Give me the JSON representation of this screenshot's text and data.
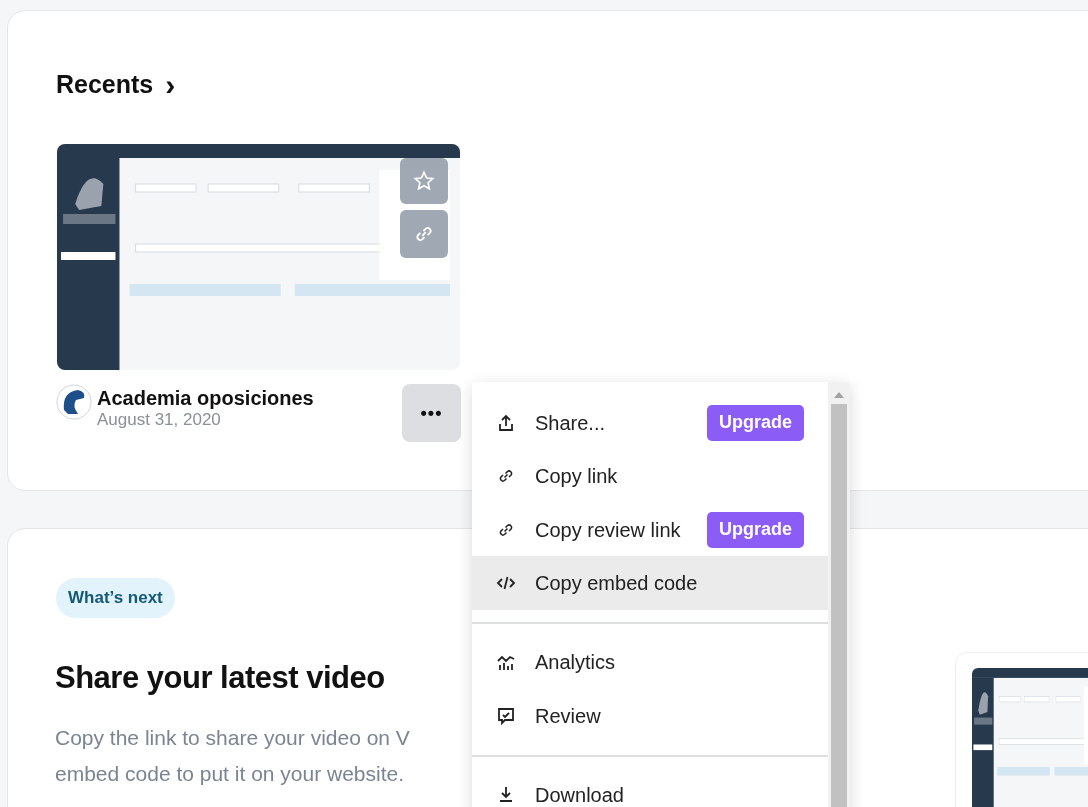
{
  "recents": {
    "title": "Recents",
    "arrow": "›",
    "video": {
      "kind": "picture",
      "title": "Academia oposiciones",
      "date": "August 31, 2020",
      "more": "•••"
    }
  },
  "menu": {
    "items": [
      {
        "kind": "item",
        "label": "Share...",
        "badge": "Upgrade",
        "selected": false
      },
      {
        "kind": "item",
        "label": "Copy link",
        "selected": false
      },
      {
        "kind": "item",
        "label": "Copy review link",
        "badge": "Upgrade",
        "selected": false
      },
      {
        "kind": "item",
        "label": "Copy embed code",
        "selected": true
      },
      {
        "kind": "divider"
      },
      {
        "kind": "item",
        "label": "Analytics",
        "selected": false
      },
      {
        "kind": "item",
        "label": "Review",
        "selected": false
      },
      {
        "kind": "divider"
      },
      {
        "kind": "item",
        "label": "Download",
        "selected": false
      }
    ]
  },
  "whats_next": {
    "badge": "What’s next",
    "title": "Share your latest video",
    "description_lines": [
      "Copy the link to share your video on V",
      "embed code to put it on your website."
    ]
  }
}
